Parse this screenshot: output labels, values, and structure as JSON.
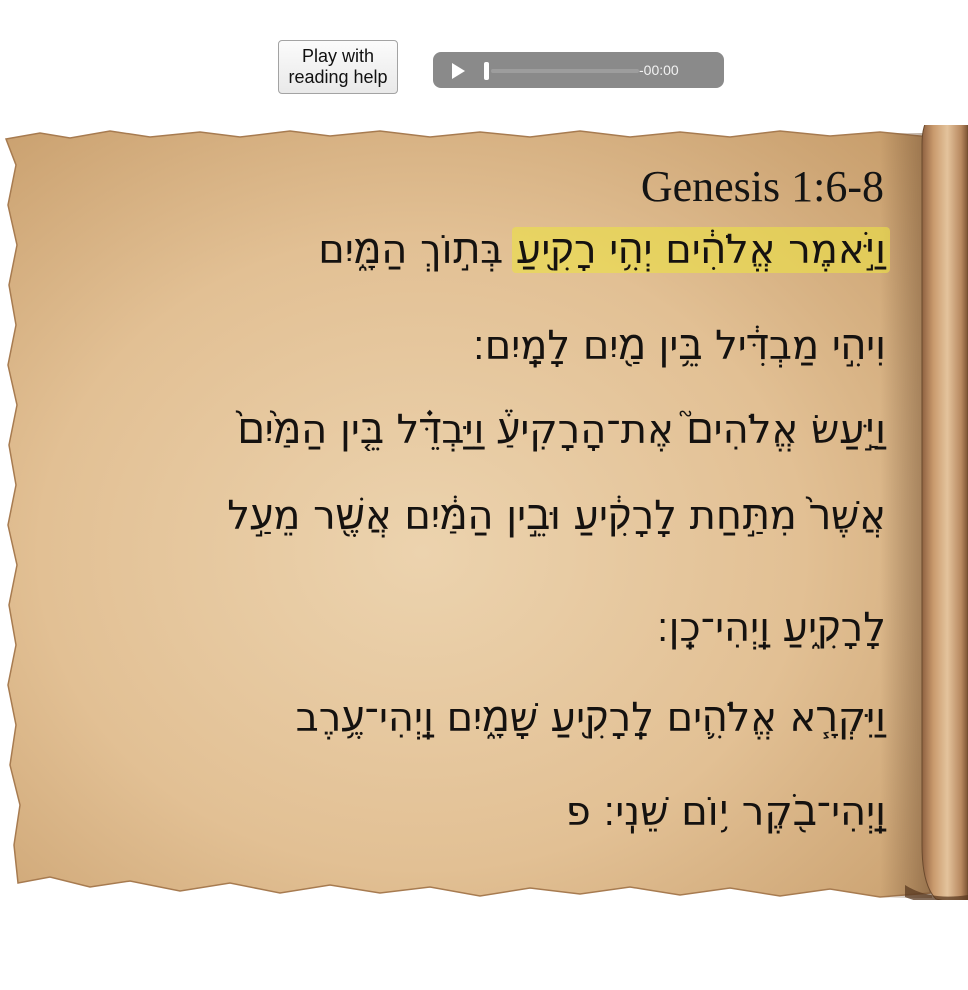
{
  "controls": {
    "play_help_label": "Play with\nreading help",
    "audio_time": "-00:00",
    "audio_progress": 0
  },
  "passage": {
    "reference": "Genesis 1:6-8",
    "lines": [
      {
        "highlight": "וַיֹּ֣אמֶר אֱלֹהִ֔ים יְהִ֥י רָקִ֖יעַ",
        "rest": " בְּת֣וֹךְ הַמָּ֑יִם"
      },
      {
        "text": "וִיהִ֣י מַבְדִּ֔יל בֵּ֥ין מַ֖יִם לָמָֽיִם׃"
      },
      {
        "text": "וַיַּ֣עַשׂ אֱלֹהִים֮ אֶת־הָרָקִיעַ֒ וַיַּבְדֵּ֗ל בֵּ֤ין הַמַּ֙יִם֙"
      },
      {
        "text": "אֲשֶׁר֙ מִתַּ֣חַת לָרָקִ֔יעַ וּבֵ֣ין הַמַּ֔יִם אֲשֶׁ֖ר מֵעַ֣ל"
      },
      {
        "text": "לָרָקִ֑יעַ וַֽיְהִי־כֵֽן׃"
      },
      {
        "text": "וַיִּקְרָ֧א אֱלֹהִ֛ים לָֽרָקִ֖יעַ שָׁמָ֑יִם וַֽיְהִי־עֶ֥רֶב"
      },
      {
        "text": "וַֽיְהִי־בֹ֖קֶר י֥וֹם שֵׁנִֽי׃ פ"
      }
    ]
  },
  "colors": {
    "parchment_light": "#ecd3ae",
    "parchment_dark": "#c79d6b",
    "highlight": "#ebe146"
  }
}
